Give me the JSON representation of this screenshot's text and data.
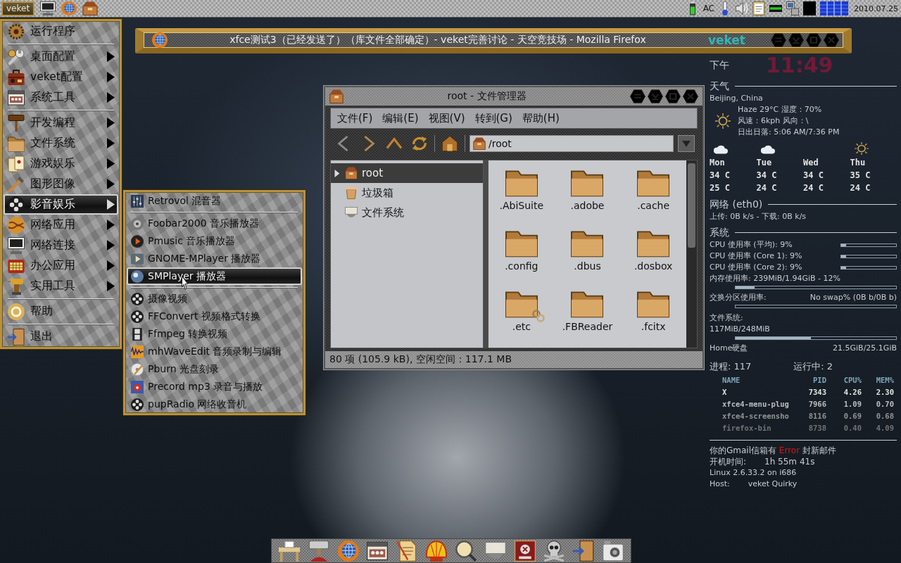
{
  "top_panel": {
    "start_button": "veket",
    "power": "AC",
    "date": "2010.07.25"
  },
  "main_menu": {
    "sections": [
      {
        "items": [
          {
            "label": "运行程序",
            "submenu": false,
            "selected": false
          }
        ]
      },
      {
        "items": [
          {
            "label": "桌面配置",
            "submenu": true,
            "selected": false
          },
          {
            "label": "veket配置",
            "submenu": true,
            "selected": false
          },
          {
            "label": "系统工具",
            "submenu": true,
            "selected": false
          }
        ]
      },
      {
        "items": [
          {
            "label": "开发编程",
            "submenu": true,
            "selected": false
          },
          {
            "label": "文件系统",
            "submenu": true,
            "selected": false
          },
          {
            "label": "游戏娱乐",
            "submenu": true,
            "selected": false
          },
          {
            "label": "图形图像",
            "submenu": true,
            "selected": false
          },
          {
            "label": "影音娱乐",
            "submenu": true,
            "selected": true
          },
          {
            "label": "网络应用",
            "submenu": true,
            "selected": false
          },
          {
            "label": "网络连接",
            "submenu": true,
            "selected": false
          },
          {
            "label": "办公应用",
            "submenu": true,
            "selected": false
          },
          {
            "label": "实用工具",
            "submenu": true,
            "selected": false
          }
        ]
      },
      {
        "items": [
          {
            "label": "帮助",
            "submenu": false,
            "selected": false
          }
        ]
      },
      {
        "items": [
          {
            "label": "退出",
            "submenu": false,
            "selected": false
          }
        ]
      }
    ]
  },
  "submenu": {
    "sections": [
      {
        "items": [
          {
            "label": "Retrovol 混音器",
            "selected": false
          }
        ]
      },
      {
        "items": [
          {
            "label": "Foobar2000 音乐播放器",
            "selected": false
          },
          {
            "label": "Pmusic 音乐播放器",
            "selected": false
          },
          {
            "label": "GNOME-MPlayer 播放器",
            "selected": false
          },
          {
            "label": "SMPlayer 播放器",
            "selected": true
          }
        ]
      },
      {
        "items": [
          {
            "label": "摄像视频",
            "selected": false
          },
          {
            "label": "FFConvert 视频格式转换",
            "selected": false
          },
          {
            "label": "Ffmpeg 转换视频",
            "selected": false
          },
          {
            "label": "mhWaveEdit 音频录制与编辑",
            "selected": false
          },
          {
            "label": "Pburn 光盘刻录",
            "selected": false
          },
          {
            "label": "Precord mp3 录音与播放",
            "selected": false
          },
          {
            "label": "pupRadio 网络收音机",
            "selected": false
          }
        ]
      }
    ]
  },
  "browser_window": {
    "title": "xfce测试3（已经发送了）（库文件全部确定）- veket完善讨论 - 天空竞技场 - Mozilla Firefox",
    "badge": "veket"
  },
  "file_manager": {
    "title": "root - 文件管理器",
    "menu": [
      "文件(F)",
      "编辑(E)",
      "视图(V)",
      "转到(G)",
      "帮助(H)"
    ],
    "location": "/root",
    "sidebar": [
      {
        "label": "root",
        "expandable": true,
        "selected": true
      },
      {
        "label": "垃圾箱",
        "expandable": false,
        "selected": false
      },
      {
        "label": "文件系统",
        "expandable": false,
        "selected": false
      }
    ],
    "files": [
      {
        "name": ".AbiSuite",
        "link": false
      },
      {
        "name": ".adobe",
        "link": false
      },
      {
        "name": ".cache",
        "link": false
      },
      {
        "name": ".config",
        "link": false
      },
      {
        "name": ".dbus",
        "link": false
      },
      {
        "name": ".dosbox",
        "link": false
      },
      {
        "name": ".etc",
        "link": true
      },
      {
        "name": ".FBReader",
        "link": false
      },
      {
        "name": ".fcitx",
        "link": false
      }
    ],
    "status": "80 项 (105.9 kB), 空闲空间：117.1 MB"
  },
  "conky": {
    "clock": {
      "period": "下午",
      "time": "11:49"
    },
    "weather": {
      "heading": "天气",
      "location": "Beijing, China",
      "lines": [
        "Haze 29°C 湿度：70%",
        "风速：6kph 风向：\\",
        "日出日落: 5:06 AM/7:36 PM"
      ],
      "forecast": [
        {
          "day": "Mon",
          "high": "34 C",
          "low": "25 C",
          "kind": "cloudy"
        },
        {
          "day": "Tue",
          "high": "34 C",
          "low": "24 C",
          "kind": "cloudy"
        },
        {
          "day": "Wed",
          "high": "34 C",
          "low": "24 C"
        },
        {
          "day": "Thu",
          "high": "35 C",
          "low": "24 C",
          "kind": "sunny"
        }
      ]
    },
    "network": {
      "heading": "网络 (eth0)",
      "traffic": "上传: 0B k/s - 下载: 0B k/s"
    },
    "system": {
      "heading": "系统",
      "meters": [
        {
          "kind": "inline",
          "label": "CPU 使用率 (平均): 9%",
          "level": 0.09
        },
        {
          "kind": "inline",
          "label": "CPU 使用率 (Core 1): 9%",
          "level": 0.09
        },
        {
          "kind": "inline",
          "label": "CPU 使用率 (Core 2): 9%",
          "level": 0.09
        },
        {
          "kind": "below",
          "label": "内存使用率: 239MiB/1.94GiB - 12%",
          "level": 0.12
        },
        {
          "kind": "below",
          "label": "交换分区使用率:",
          "reading": "No swap% (0B b/0B b)"
        }
      ]
    },
    "filesystem": {
      "heading": "文件系统:",
      "meters": [
        {
          "kind": "below",
          "label": "117MiB/248MiB",
          "level": 0.47
        },
        {
          "kind": "text",
          "label": "Home硬盘",
          "reading": "21.5GiB/25.1GiB"
        }
      ]
    },
    "processes": {
      "summary": [
        "进程: 117",
        "运行中: 2"
      ],
      "columns": [
        "NAME",
        "PID",
        "CPU%",
        "MEM%"
      ],
      "rows": [
        [
          "X",
          "7343",
          "4.26",
          "2.30"
        ],
        [
          "xfce4-menu-plug",
          "7966",
          "1.09",
          "0.70"
        ],
        [
          "xfce4-screensho",
          "8116",
          "0.69",
          "0.68"
        ],
        [
          "firefox-bin",
          "8738",
          "0.40",
          "4.09"
        ]
      ]
    },
    "mail": {
      "before": "你的Gmail信箱有",
      "status": "Error",
      "after": "封新邮件"
    },
    "uptime": {
      "label": "开机时间:",
      "value": "1h 55m 41s"
    },
    "kernel": "Linux 2.6.33.2 on i686",
    "host": {
      "label": "Host:",
      "value": "veket Quirky"
    }
  }
}
